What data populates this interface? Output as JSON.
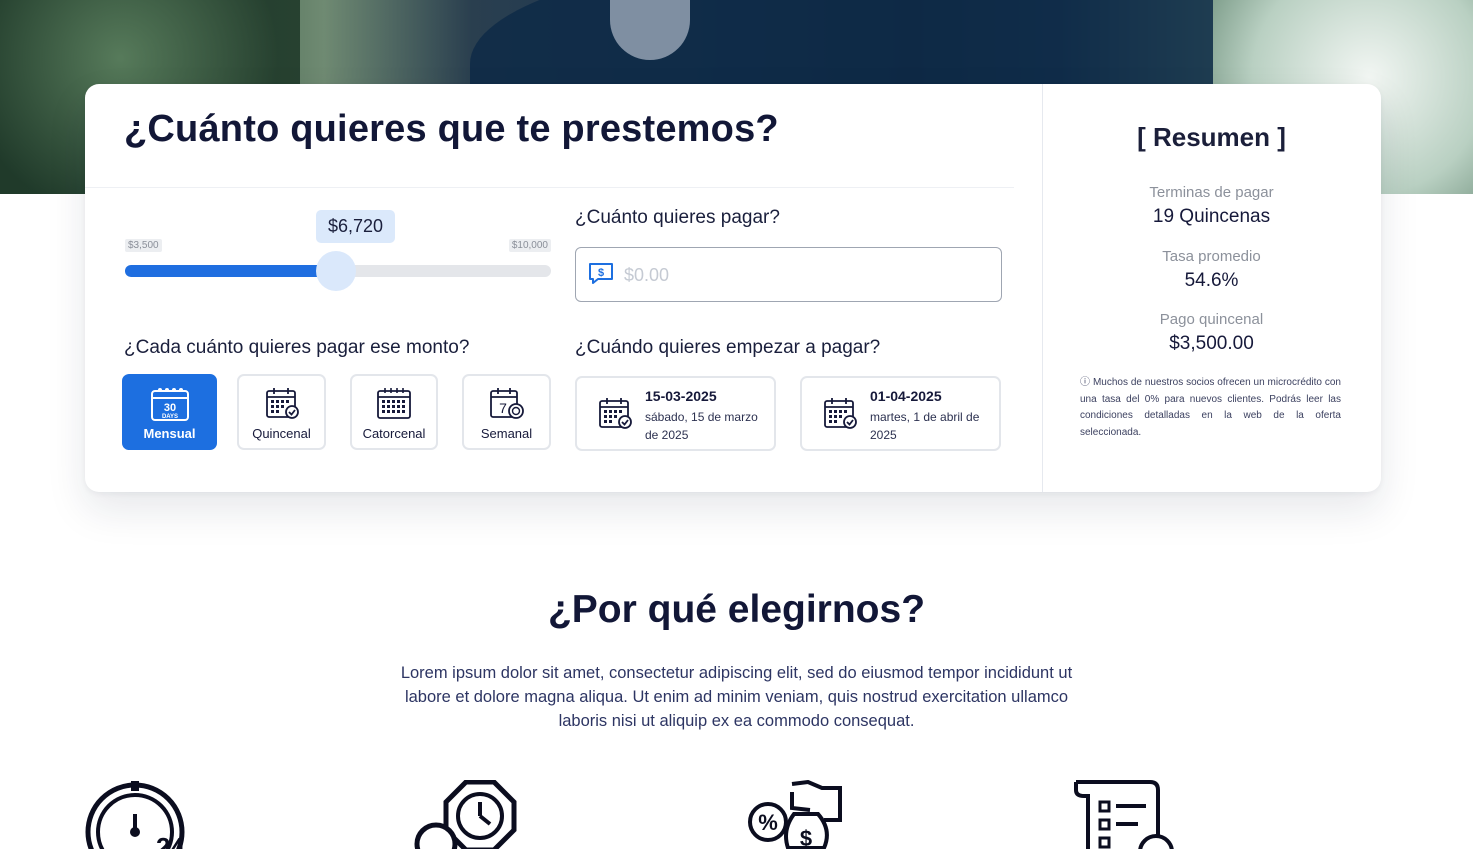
{
  "calculator": {
    "title": "¿Cuánto quieres que te prestemos?",
    "slider": {
      "value_label": "$6,720",
      "min_label": "$3,500",
      "max_label": "$10,000",
      "value": 6720,
      "min": 3500,
      "max": 10000
    },
    "payment": {
      "label": "¿Cuánto quieres pagar?",
      "placeholder": "$0.00",
      "icon": "money-chat-icon"
    },
    "frequency": {
      "label": "¿Cada cuánto quieres pagar ese monto?",
      "options": [
        {
          "label": "Mensual",
          "icon": "calendar-30-days-icon",
          "selected": true
        },
        {
          "label": "Quincenal",
          "icon": "calendar-check-icon",
          "selected": false
        },
        {
          "label": "Catorcenal",
          "icon": "calendar-grid-icon",
          "selected": false
        },
        {
          "label": "Semanal",
          "icon": "calendar-7-icon",
          "selected": false
        }
      ]
    },
    "start": {
      "label": "¿Cuándo quieres empezar a pagar?",
      "options": [
        {
          "date": "15-03-2025",
          "long": "sábado, 15 de marzo de 2025"
        },
        {
          "date": "01-04-2025",
          "long": "martes, 1 de abril de 2025"
        }
      ]
    }
  },
  "summary": {
    "title": "[ Resumen ]",
    "items": [
      {
        "label": "Terminas de pagar",
        "value": "19 Quincenas"
      },
      {
        "label": "Tasa promedio",
        "value": "54.6%"
      },
      {
        "label": "Pago quincenal",
        "value": "$3,500.00"
      }
    ],
    "note": "ⓘ Muchos de nuestros socios ofrecen un microcrédito con una tasa del 0% para nuevos clientes. Podrás leer las condiciones detalladas en la web de la oferta seleccionada."
  },
  "why": {
    "title": "¿Por qué elegirnos?",
    "text": "Lorem ipsum dolor sit amet, consectetur adipiscing elit, sed do eiusmod tempor incididunt ut labore et dolore magna aliqua. Ut enim ad minim veniam, quis nostrud exercitation ullamco laboris nisi ut aliquip ex ea commodo consequat.",
    "features": [
      {
        "icon": "clock-24-hours-icon"
      },
      {
        "icon": "time-badge-icon"
      },
      {
        "icon": "money-bag-percent-icon"
      },
      {
        "icon": "checklist-document-icon"
      }
    ]
  },
  "colors": {
    "accent": "#1d6fe0",
    "title": "#121737",
    "bubble": "#dbe9fb"
  }
}
